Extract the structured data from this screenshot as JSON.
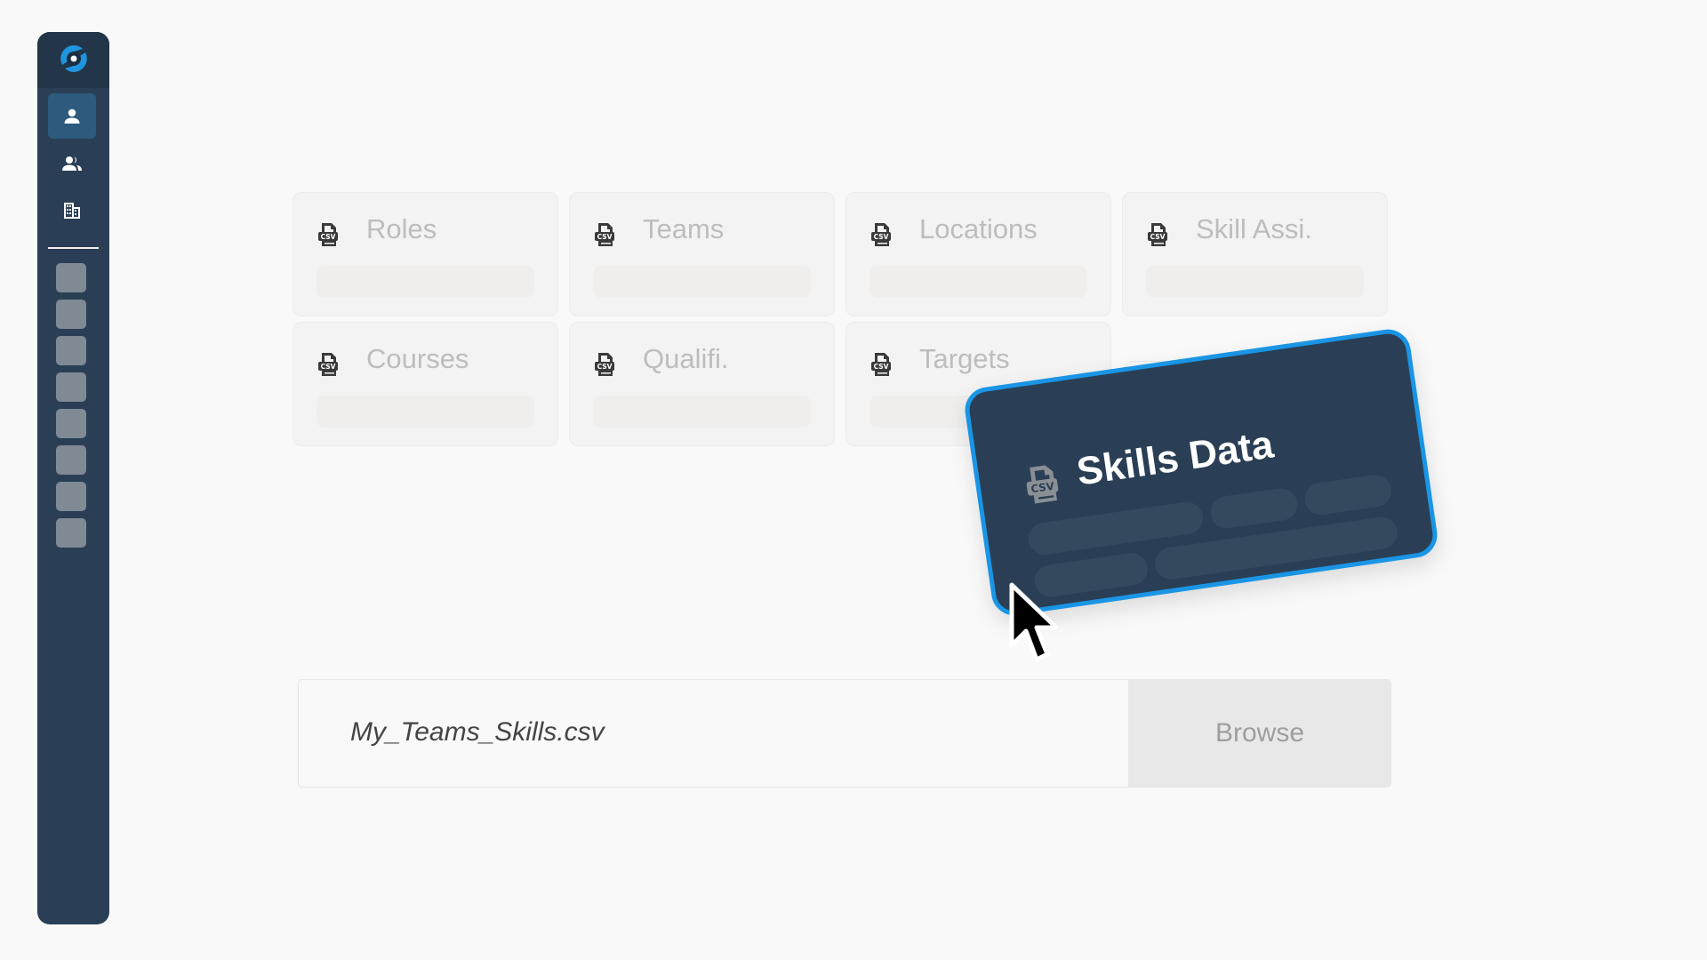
{
  "sidebar": {
    "logo": "app-logo",
    "nav": [
      {
        "icon": "person-icon",
        "active": true
      },
      {
        "icon": "people-icon",
        "active": false
      },
      {
        "icon": "building-icon",
        "active": false
      }
    ],
    "placeholder_items": 8
  },
  "import_types": [
    {
      "label": "Roles",
      "icon": "csv-file-icon"
    },
    {
      "label": "Teams",
      "icon": "csv-file-icon"
    },
    {
      "label": "Locations",
      "icon": "csv-file-icon"
    },
    {
      "label": "Skill Assi.",
      "icon": "csv-file-icon"
    },
    {
      "label": "Courses",
      "icon": "csv-file-icon"
    },
    {
      "label": "Qualifi.",
      "icon": "csv-file-icon"
    },
    {
      "label": "Targets",
      "icon": "csv-file-icon"
    }
  ],
  "dragged_card": {
    "title": "Skills Data",
    "icon": "csv-file-icon"
  },
  "file_upload": {
    "file_name": "My_Teams_Skills.csv",
    "browse_label": "Browse"
  },
  "colors": {
    "sidebar": "#2a3f55",
    "accent": "#1a95e6",
    "active_nav": "#2d5a7d"
  }
}
